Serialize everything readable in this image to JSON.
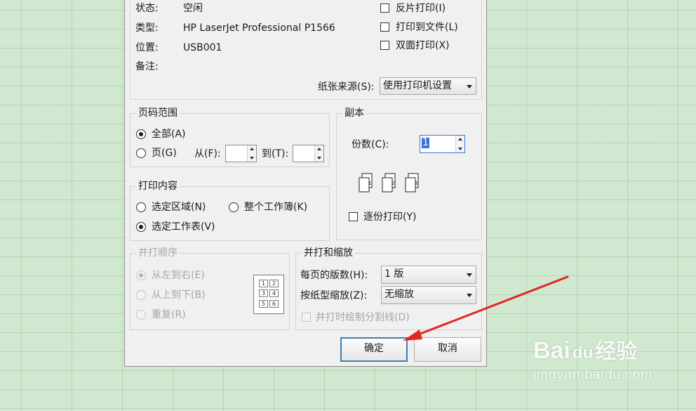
{
  "printer": {
    "status_label": "状态:",
    "status_value": "空闲",
    "type_label": "类型:",
    "type_value": "HP LaserJet Professional P1566",
    "where_label": "位置:",
    "where_value": "USB001",
    "comment_label": "备注:",
    "reverse_print_label": "反片打印(I)",
    "print_to_file_label": "打印到文件(L)",
    "duplex_label": "双面打印(X)",
    "paper_source_label": "纸张来源(S):",
    "paper_source_value": "使用打印机设置"
  },
  "page_range": {
    "title": "页码范围",
    "all_label": "全部(A)",
    "pages_label": "页(G)",
    "from_label": "从(F):",
    "to_label": "到(T):"
  },
  "copies": {
    "title": "副本",
    "count_label": "份数(C):",
    "count_value": "1",
    "collate_label": "逐份打印(Y)"
  },
  "print_what": {
    "title": "打印内容",
    "selection_label": "选定区域(N)",
    "workbook_label": "整个工作簿(K)",
    "sheet_label": "选定工作表(V)"
  },
  "order": {
    "title": "并打顺序",
    "left_right_label": "从左到右(E)",
    "top_bottom_label": "从上到下(B)",
    "repeat_label": "重复(R)",
    "grid_numbers": [
      "1",
      "2",
      "3",
      "4",
      "5",
      "6"
    ]
  },
  "zoom": {
    "title": "并打和缩放",
    "pages_per_sheet_label": "每页的版数(H):",
    "pages_per_sheet_value": "1 版",
    "scale_label": "按纸型缩放(Z):",
    "scale_value": "无缩放",
    "divider_label": "并打时绘制分割线(D)"
  },
  "buttons": {
    "ok": "确定",
    "cancel": "取消"
  },
  "watermark": {
    "brand": "Bai",
    "paw": "du",
    "cn": "经验",
    "url": "jingyan.baidu.com"
  },
  "colors": {
    "arrow": "#e0271f",
    "selection": "#3875d7",
    "sheet_bg": "#cfe8cf"
  },
  "icons": {
    "copy_pages": [
      "1",
      "2",
      "3"
    ]
  }
}
